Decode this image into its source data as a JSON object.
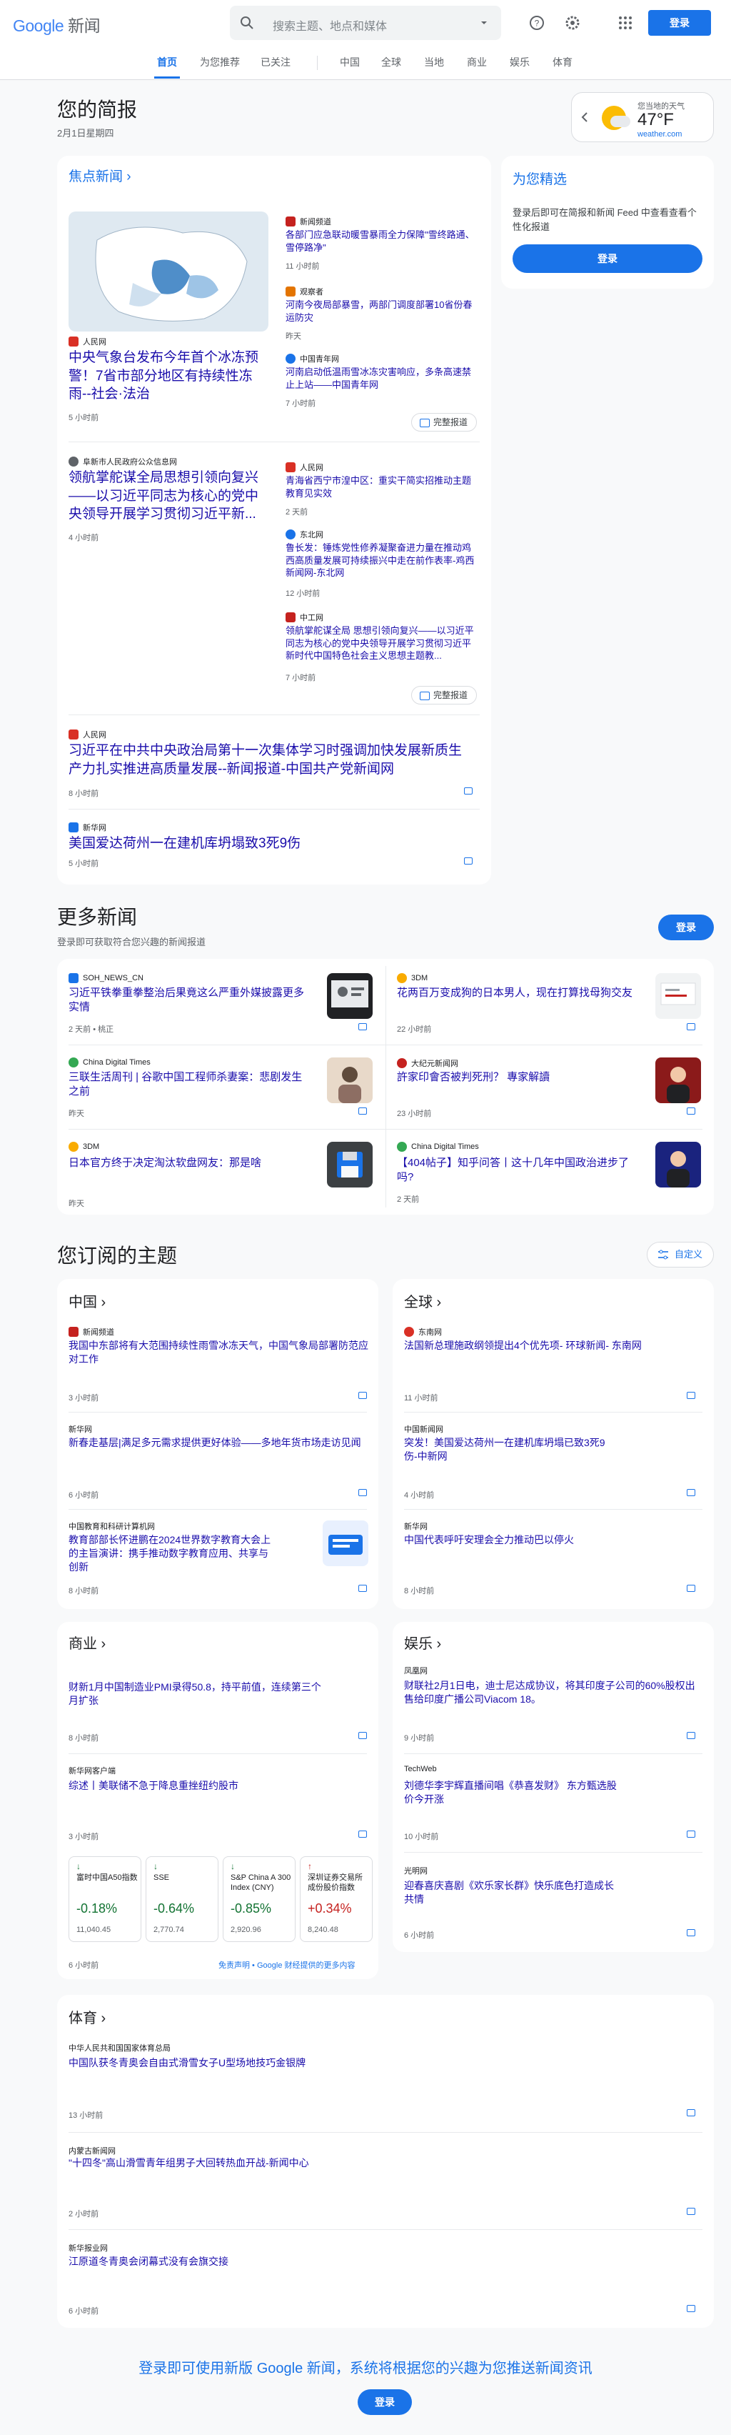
{
  "header": {
    "logo_google": "Google",
    "logo_news": "新闻",
    "search_placeholder": "搜索主题、地点和媒体",
    "sign_in": "登录"
  },
  "nav": [
    "首页",
    "为您推荐",
    "已关注",
    "中国",
    "全球",
    "当地",
    "商业",
    "娱乐",
    "体育"
  ],
  "briefing": {
    "title": "您的简报",
    "date": "2月1日星期四"
  },
  "weather": {
    "label": "您当地的天气",
    "temp": "47°F",
    "source": "weather.com"
  },
  "top": {
    "title": "焦点新闻",
    "coverage": "完整报道",
    "main": {
      "source": "人民网",
      "title": "中央气象台发布今年首个冰冻预警！7省市部分地区有持续性冻雨--社会·法治",
      "time": "5 小时前"
    },
    "side": [
      {
        "source": "新闻频道",
        "title": "各部门应急联动暖雪暴雨全力保障\"雪终路通、雪停路净\"",
        "time": "11 小时前"
      },
      {
        "source": "观察者",
        "title": "河南今夜局部暴雪，两部门调度部署10省份春运防灾",
        "time": "昨天"
      },
      {
        "source": "中国青年网",
        "title": "河南启动低温雨雪冰冻灾害响应，多条高速禁止上站——中国青年网",
        "time": "7 小时前"
      }
    ],
    "main2": {
      "source": "阜新市人民政府公众信息网",
      "title": "领航掌舵谋全局思想引领向复兴——以习近平同志为核心的党中央领导开展学习贯彻习近平新...",
      "time": "4 小时前"
    },
    "side2": [
      {
        "source": "人民网",
        "title": "青海省西宁市湟中区：重实干简实招推动主题教育见实效",
        "time": "2 天前"
      },
      {
        "source": "东北网",
        "title": "鲁长发：锤炼党性修养凝聚奋进力量在推动鸡西高质量发展可持续振兴中走在前作表率-鸡西新闻网-东北网",
        "time": "12 小时前"
      },
      {
        "source": "中工网",
        "title": "领航掌舵谋全局 思想引领向复兴——以习近平同志为核心的党中央领导开展学习贯彻习近平新时代中国特色社会主义思想主题教...",
        "time": "7 小时前"
      }
    ],
    "wide": [
      {
        "source": "人民网",
        "title": "习近平在中共中央政治局第十一次集体学习时强调加快发展新质生产力扎实推进高质量发展--新闻报道-中国共产党新闻网",
        "time": "8 小时前"
      },
      {
        "source": "新华网",
        "title": "美国爱达荷州一在建机库坍塌致3死9伤",
        "time": "5 小时前"
      }
    ]
  },
  "foryou": {
    "title": "为您精选",
    "desc": "登录后即可在简报和新闻 Feed 中查看查看个性化报道",
    "button": "登录"
  },
  "more": {
    "title": "更多新闻",
    "sub": "登录即可获取符合您兴趣的新闻报道",
    "button": "登录",
    "items": [
      {
        "source": "SOH_NEWS_CN",
        "title": "习近平铁拳重拳整治后果竟这么严重外媒披露更多实情",
        "time": "2 天前 • 桃正"
      },
      {
        "source": "3DM",
        "title": "花两百万变成狗的日本男人，现在打算找母狗交友",
        "time": "22 小时前"
      },
      {
        "source": "China Digital Times",
        "title": "三联生活周刊 | 谷歌中国工程师杀妻案：悲剧发生之前",
        "time": "昨天"
      },
      {
        "source": "大纪元新闻网",
        "title": "許家印會否被判死刑？ 專家解讀",
        "time": "23 小时前"
      },
      {
        "source": "3DM",
        "title": "日本官方终于决定淘汰软盘网友：那是啥",
        "time": "昨天"
      },
      {
        "source": "China Digital Times",
        "title": "【404帖子】知乎问答丨这十几年中国政治进步了吗?",
        "time": "2 天前"
      }
    ]
  },
  "topics": {
    "title": "您订阅的主题",
    "customize": "自定义",
    "china": {
      "name": "中国",
      "items": [
        {
          "source": "新闻频道",
          "title": "我国中东部将有大范围持续性雨雪冰冻天气，中国气象局部署防范应对工作",
          "time": "3 小时前"
        },
        {
          "source": "新华网",
          "title": "新春走基层|满足多元需求提供更好体验——多地年货市场走访见闻",
          "time": "6 小时前"
        },
        {
          "source": "中国教育和科研计算机网",
          "title": "教育部部长怀进鹏在2024世界数字教育大会上的主旨演讲：携手推动数字教育应用、共享与创新",
          "time": "8 小时前"
        }
      ]
    },
    "world": {
      "name": "全球",
      "items": [
        {
          "source": "东南网",
          "title": "法国新总理施政纲领提出4个优先项- 环球新闻- 东南网",
          "time": "11 小时前"
        },
        {
          "source": "中国新闻网",
          "title": "突发！美国爱达荷州一在建机库坍塌已致3死9伤-中新网",
          "time": "4 小时前"
        },
        {
          "source": "新华网",
          "title": "中国代表呼吁安理会全力推动巴以停火",
          "time": "8 小时前"
        }
      ]
    },
    "business": {
      "name": "商业",
      "items": [
        {
          "source": "",
          "title": "财新1月中国制造业PMI录得50.8，持平前值，连续第三个月扩张",
          "time": "8 小时前"
        },
        {
          "source": "新华网客户端",
          "title": "综述丨美联储不急于降息重挫纽约股市",
          "time": "3 小时前"
        }
      ],
      "stocks": [
        {
          "name": "富时中国A50指数",
          "change": "-0.18%",
          "value": "11,040.45",
          "up": false
        },
        {
          "name": "SSE",
          "change": "-0.64%",
          "value": "2,770.74",
          "up": false
        },
        {
          "name": "S&P China A 300 Index (CNY)",
          "change": "-0.85%",
          "value": "2,920.96",
          "up": false
        },
        {
          "name": "深圳证券交易所成份股价指数",
          "change": "+0.34%",
          "value": "8,240.48",
          "up": true
        }
      ],
      "time": "6 小时前",
      "disclaimer": "免责声明 • Google 财经提供的更多内容"
    },
    "ent": {
      "name": "娱乐",
      "items": [
        {
          "source": "凤凰网",
          "title": "财联社2月1日电，迪士尼达成协议，将其印度子公司的60%股权出售给印度广播公司Viacom 18。",
          "time": "9 小时前"
        },
        {
          "source": "TechWeb",
          "title": "刘德华李宇辉直播间唱《恭喜发财》 东方甄选股价今开涨",
          "time": "10 小时前"
        },
        {
          "source": "光明网",
          "title": "迎春喜庆喜剧《欢乐家长群》快乐底色打造成长共情",
          "time": "6 小时前"
        }
      ]
    },
    "sports": {
      "name": "体育",
      "items": [
        {
          "source": "中华人民共和国国家体育总局",
          "title": "中国队获冬青奥会自由式滑雪女子U型场地技巧金银牌",
          "time": "13 小时前"
        },
        {
          "source": "内蒙古新闻网",
          "title": "\"十四冬\"高山滑雪青年组男子大回转热血开战-新闻中心",
          "time": "2 小时前"
        },
        {
          "source": "新华报业网",
          "title": "江原道冬青奥会闭幕式没有会旗交接",
          "time": "6 小时前"
        }
      ]
    }
  },
  "footer": {
    "text": "登录即可使用新版 Google 新闻，系统将根据您的兴趣为您推送新闻资讯",
    "button": "登录"
  },
  "colors": {
    "accent": "#1a73e8",
    "positive": "#137333",
    "negative": "#c5221f"
  }
}
